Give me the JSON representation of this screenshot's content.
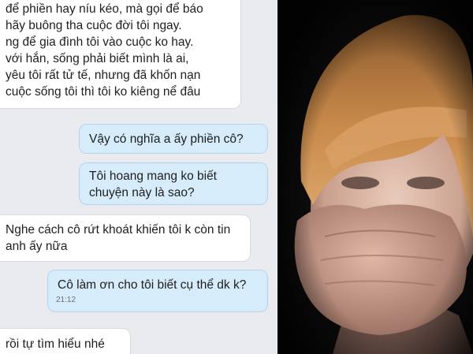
{
  "chat": {
    "messages": [
      {
        "side": "incoming",
        "text": "để phiền hay níu kéo, mà gọi để báo\nhãy buông tha cuộc đời tôi ngay.\nng để gia đình tôi vào cuộc ko hay.\nvới hắn, sống phải biết mình là ai,\nyêu tôi rất tử tế, nhưng đã khốn nạn\ncuộc sống tôi thì tôi ko kiêng nể đâu"
      },
      {
        "side": "outgoing",
        "text": "Vậy có nghĩa a ấy phiền cô?"
      },
      {
        "side": "outgoing",
        "text": "Tôi hoang mang ko biết chuyện này là sao?"
      },
      {
        "side": "incoming",
        "text": "Nghe cách cô rứt khoát khiến tôi k còn tin anh ấy nữa"
      },
      {
        "side": "outgoing",
        "text": "Cô làm ơn cho tôi biết cụ thể dk k?",
        "time": "21:12"
      },
      {
        "side": "incoming",
        "text": "rồi tự tìm hiểu nhé"
      }
    ]
  },
  "colors": {
    "chat_background": "#e9ebee",
    "incoming_bubble": "#ffffff",
    "outgoing_bubble": "#d7ecfb",
    "photo_background": "#0b0b0b",
    "hair": "#c98a4a"
  }
}
